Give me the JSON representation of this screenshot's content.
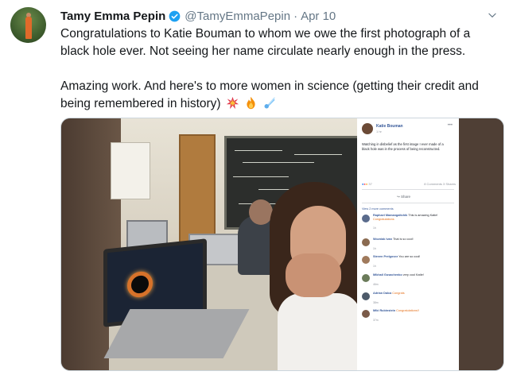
{
  "tweet": {
    "author_name": "Tamy Emma Pepin",
    "handle": "@TamyEmmaPepin",
    "separator": "·",
    "date": "Apr 10",
    "paragraph1": "Congratulations to Katie Bouman to whom we owe the first photograph of a black hole ever. Not seeing her name circulate nearly enough in the press.",
    "paragraph2": "Amazing work. And here's to more women in science (getting their credit and being remembered in history)",
    "emojis": [
      "collision-icon",
      "fire-icon",
      "comet-icon"
    ]
  },
  "fb_post": {
    "name": "Katie Bouman",
    "time": "1 hr",
    "text": "Watching in disbelief as the first image I ever made of a black hole was in the process of being reconstructed.",
    "reactions": "37",
    "counts": "8 Comments 3 Shares",
    "share_label": "Share",
    "view_previous": "View 2 more comments",
    "comments": [
      {
        "name": "Raphael Mamangaltchik",
        "text": "This is amazing Katie!",
        "highlight": "Congratulations",
        "meta": "1h"
      },
      {
        "name": "Wozniak Ivan",
        "text": "That is so cool!",
        "highlight": "",
        "meta": "1h"
      },
      {
        "name": "Steven Prelgovor",
        "text": "You are so cool!",
        "highlight": "",
        "meta": "1h"
      },
      {
        "name": "Mikhail Gusachenko",
        "text": "very cool Katie!",
        "highlight": "",
        "meta": "46m"
      },
      {
        "name": "Adrian Dalca",
        "text": "",
        "highlight": "Congrats",
        "meta": "38m"
      },
      {
        "name": "Miki Rubinstein",
        "text": "",
        "highlight": "Congratulations!!",
        "meta": "37m"
      }
    ]
  },
  "colors": {
    "text": "#14171a",
    "muted": "#657786",
    "verified": "#1da1f2",
    "fb_link": "#365899"
  }
}
